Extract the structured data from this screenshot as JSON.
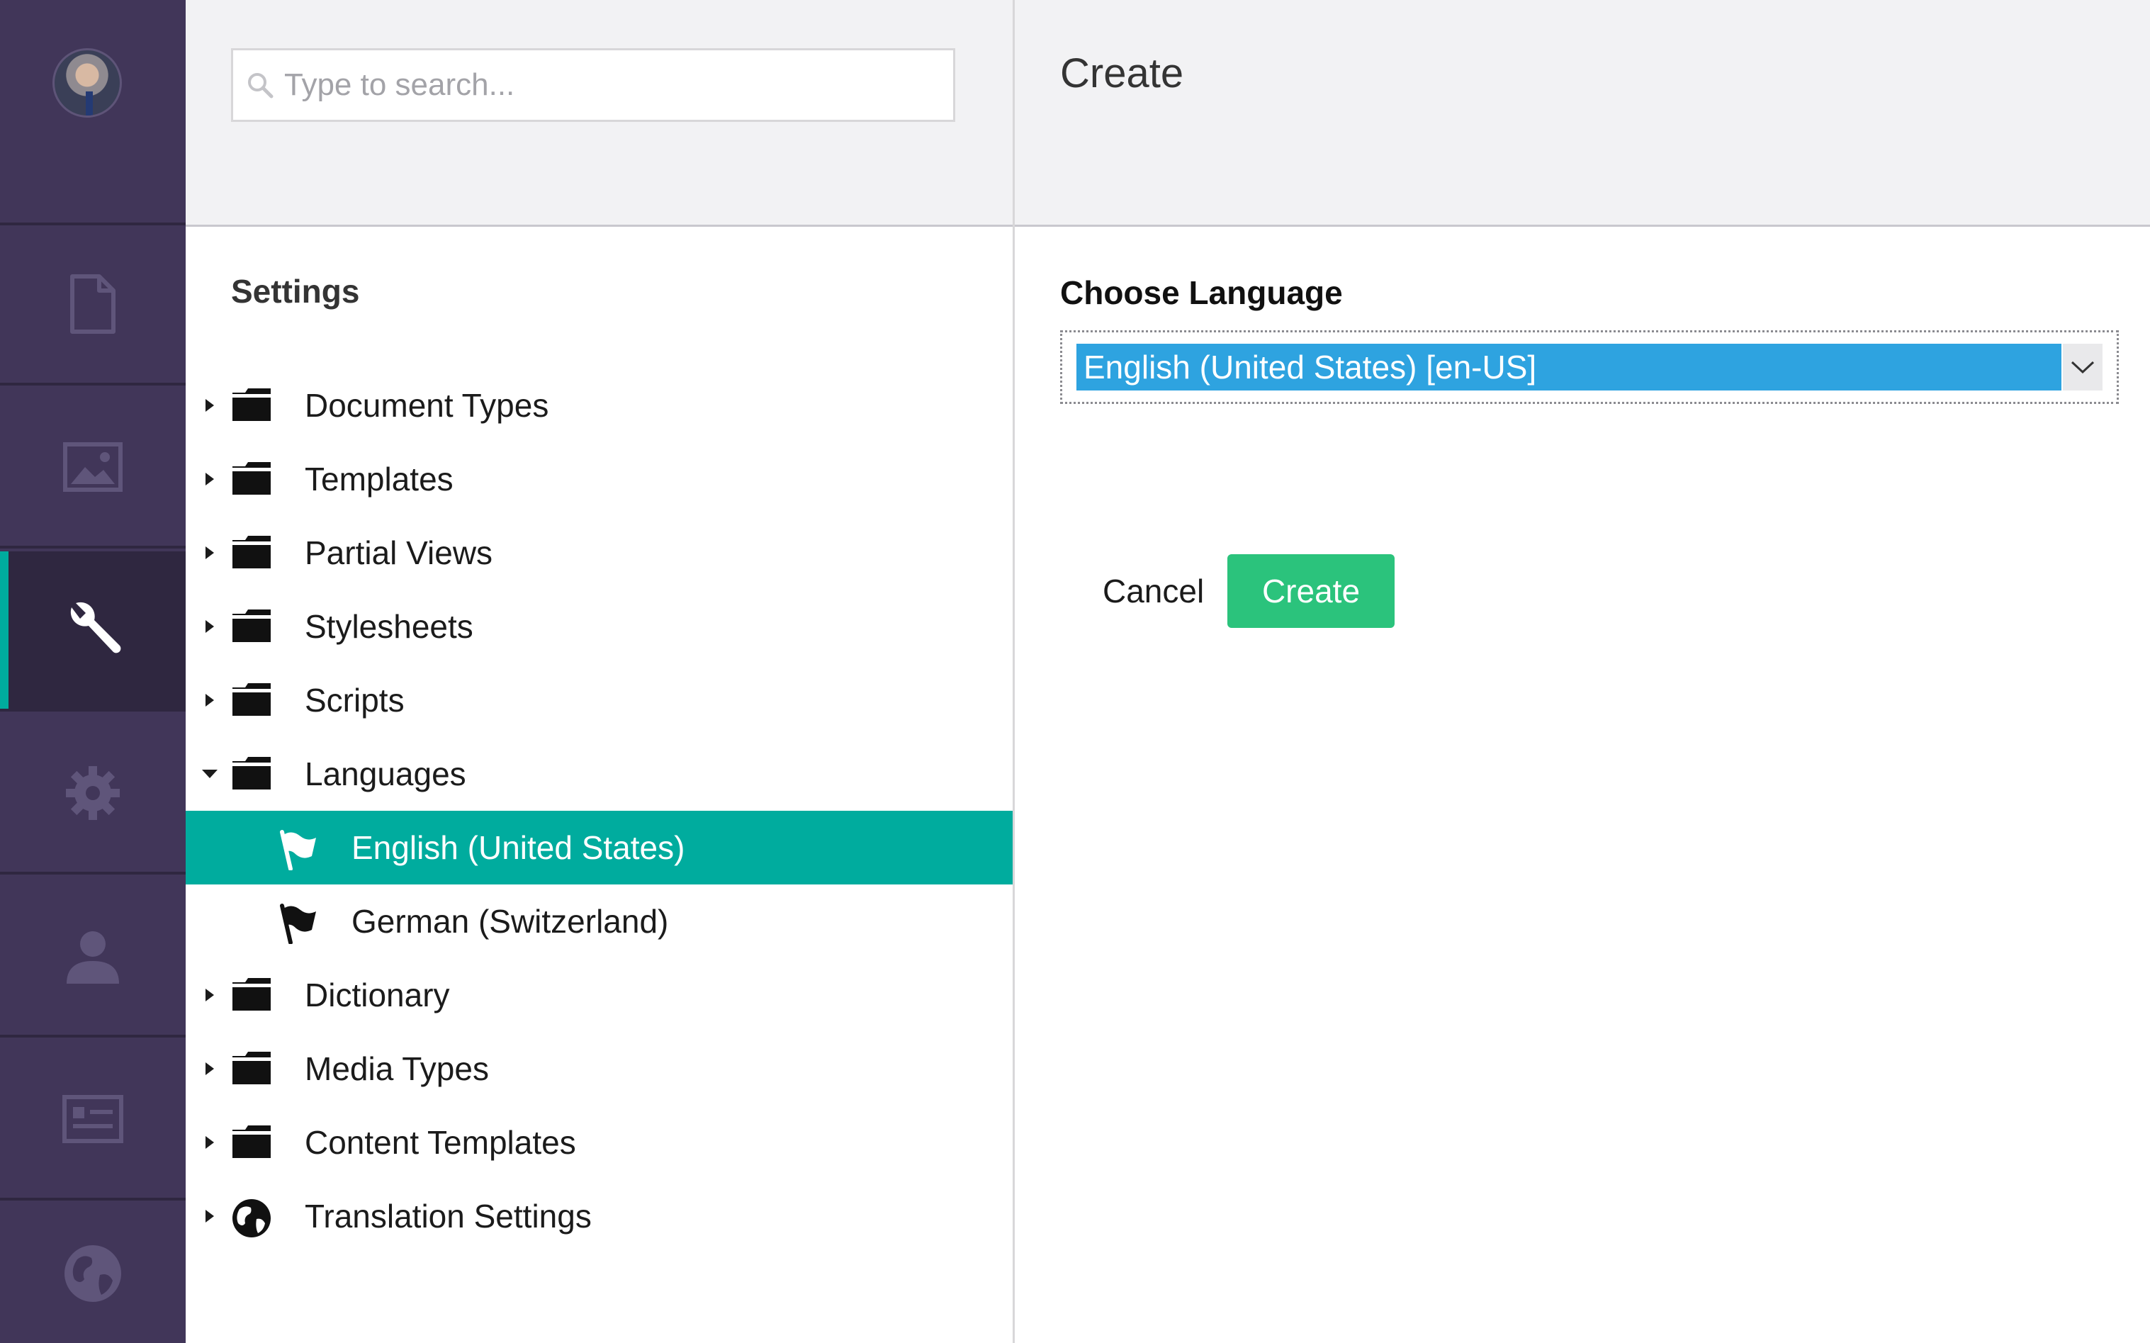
{
  "search": {
    "placeholder": "Type to search..."
  },
  "tree": {
    "title": "Settings",
    "items": [
      {
        "label": "Document Types",
        "icon": "folder-icon",
        "expanded": false
      },
      {
        "label": "Templates",
        "icon": "folder-icon",
        "expanded": false
      },
      {
        "label": "Partial Views",
        "icon": "folder-icon",
        "expanded": false
      },
      {
        "label": "Stylesheets",
        "icon": "folder-icon",
        "expanded": false
      },
      {
        "label": "Scripts",
        "icon": "folder-icon",
        "expanded": false
      },
      {
        "label": "Languages",
        "icon": "folder-icon",
        "expanded": true,
        "children": [
          {
            "label": "English (United States)",
            "icon": "flag-icon",
            "selected": true
          },
          {
            "label": "German (Switzerland)",
            "icon": "flag-icon",
            "selected": false
          }
        ]
      },
      {
        "label": "Dictionary",
        "icon": "folder-icon",
        "expanded": false
      },
      {
        "label": "Media Types",
        "icon": "folder-icon",
        "expanded": false
      },
      {
        "label": "Content Templates",
        "icon": "folder-icon",
        "expanded": false
      },
      {
        "label": "Translation Settings",
        "icon": "globe-icon",
        "expanded": false
      }
    ]
  },
  "sections": [
    "content-icon",
    "media-icon",
    "settings-wrench-icon",
    "developer-gear-icon",
    "users-icon",
    "members-icon",
    "translation-globe-icon"
  ],
  "editor": {
    "title": "Create",
    "field_label": "Choose Language",
    "selected_language": "English (United States) [en-US]",
    "cancel_label": "Cancel",
    "create_label": "Create"
  },
  "colors": {
    "rail": "#413659",
    "accent_selected": "#00ac9e",
    "create_button": "#2bc37c",
    "select_highlight": "#2ea3e0"
  }
}
